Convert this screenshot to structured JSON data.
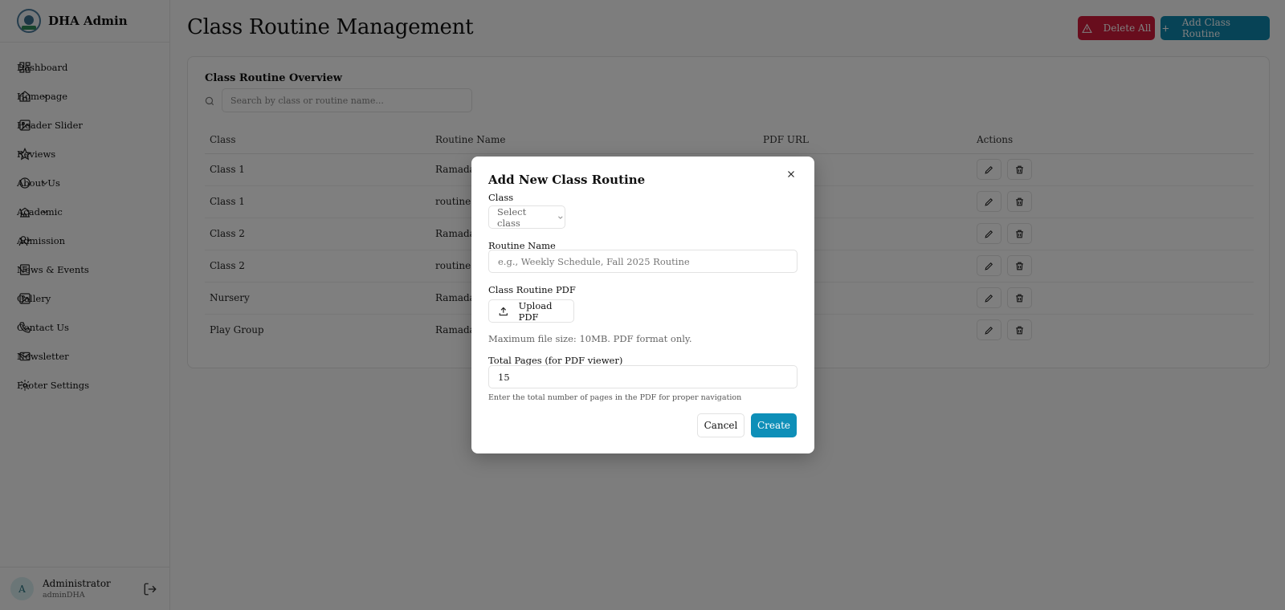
{
  "sidebar": {
    "brand": "DHA Admin",
    "items": [
      {
        "label": "Dashboard",
        "icon": "dashboard-icon",
        "expandable": false
      },
      {
        "label": "Homepage",
        "icon": "home-icon",
        "expandable": true
      },
      {
        "label": "Header Slider",
        "icon": "image-icon",
        "expandable": false
      },
      {
        "label": "Reviews",
        "icon": "star-icon",
        "expandable": false
      },
      {
        "label": "About Us",
        "icon": "info-icon",
        "expandable": true
      },
      {
        "label": "Academic",
        "icon": "school-icon",
        "expandable": true
      },
      {
        "label": "Admission",
        "icon": "user-plus-icon",
        "expandable": false
      },
      {
        "label": "News & Events",
        "icon": "newspaper-icon",
        "expandable": false
      },
      {
        "label": "Gallery",
        "icon": "gallery-icon",
        "expandable": false
      },
      {
        "label": "Contact Us",
        "icon": "phone-icon",
        "expandable": false
      },
      {
        "label": "Newsletter",
        "icon": "mail-icon",
        "expandable": false
      },
      {
        "label": "Footer Settings",
        "icon": "gear-icon",
        "expandable": false
      }
    ],
    "user": {
      "avatar": "A",
      "name": "Administrator",
      "email": "adminDHA"
    }
  },
  "header": {
    "title": "Class Routine Management",
    "delete_all": "Delete All",
    "add_button": "Add Class Routine"
  },
  "overview": {
    "title": "Class Routine Overview",
    "search_placeholder": "Search by class or routine name...",
    "columns": [
      "Class",
      "Routine Name",
      "PDF URL",
      "Actions"
    ],
    "rows": [
      {
        "class": "Class 1",
        "routine": "Ramadan"
      },
      {
        "class": "Class 1",
        "routine": "routine"
      },
      {
        "class": "Class 2",
        "routine": "Ramadan"
      },
      {
        "class": "Class 2",
        "routine": "routine"
      },
      {
        "class": "Nursery",
        "routine": "Ramadan"
      },
      {
        "class": "Play Group",
        "routine": "Ramadan"
      }
    ]
  },
  "modal": {
    "title": "Add New Class Routine",
    "class_label": "Class",
    "class_placeholder": "Select class",
    "routine_label": "Routine Name",
    "routine_placeholder": "e.g., Weekly Schedule, Fall 2025 Routine",
    "pdf_label": "Class Routine PDF",
    "upload_button": "Upload PDF",
    "file_hint": "Maximum file size: 10MB. PDF format only.",
    "pages_label": "Total Pages (for PDF viewer)",
    "pages_value": "15",
    "pages_hint": "Enter the total number of pages in the PDF for proper navigation",
    "cancel": "Cancel",
    "create": "Create"
  },
  "colors": {
    "danger": "#d11a3a",
    "primary": "#0e86ac",
    "create": "#0e8fb8"
  }
}
